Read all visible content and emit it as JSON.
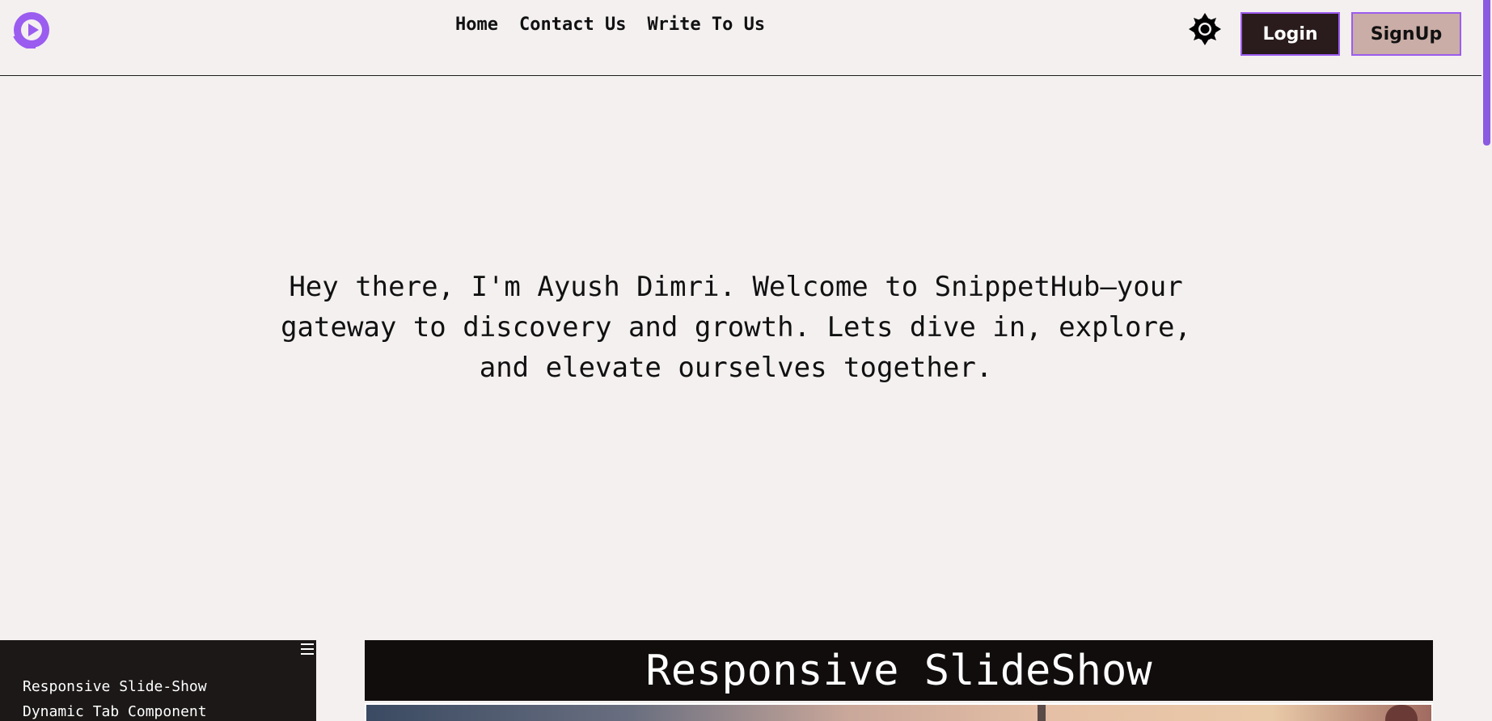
{
  "header": {
    "logo_icon": "play-logo-icon",
    "nav": [
      {
        "label": "Home"
      },
      {
        "label": "Contact Us"
      },
      {
        "label": "Write To Us"
      }
    ],
    "theme_toggle_icon": "sun-gear-icon",
    "login_label": "Login",
    "signup_label": "SignUp"
  },
  "hero": {
    "text": "Hey there, I'm Ayush Dimri. Welcome to SnippetHub—your gateway to discovery and growth. Lets dive in, explore, and elevate ourselves together."
  },
  "sidebar": {
    "menu_icon": "hamburger-menu-icon",
    "items": [
      {
        "label": "Responsive Slide-Show"
      },
      {
        "label": "Dynamic Tab Component"
      }
    ]
  },
  "slideshow": {
    "title": "Responsive SlideShow"
  },
  "colors": {
    "accent": "#9b5cf0",
    "background": "#f4f0f0",
    "login_bg": "#2a1c1c",
    "signup_bg": "#c9ada6",
    "sidebar_bg": "#1c1818"
  }
}
